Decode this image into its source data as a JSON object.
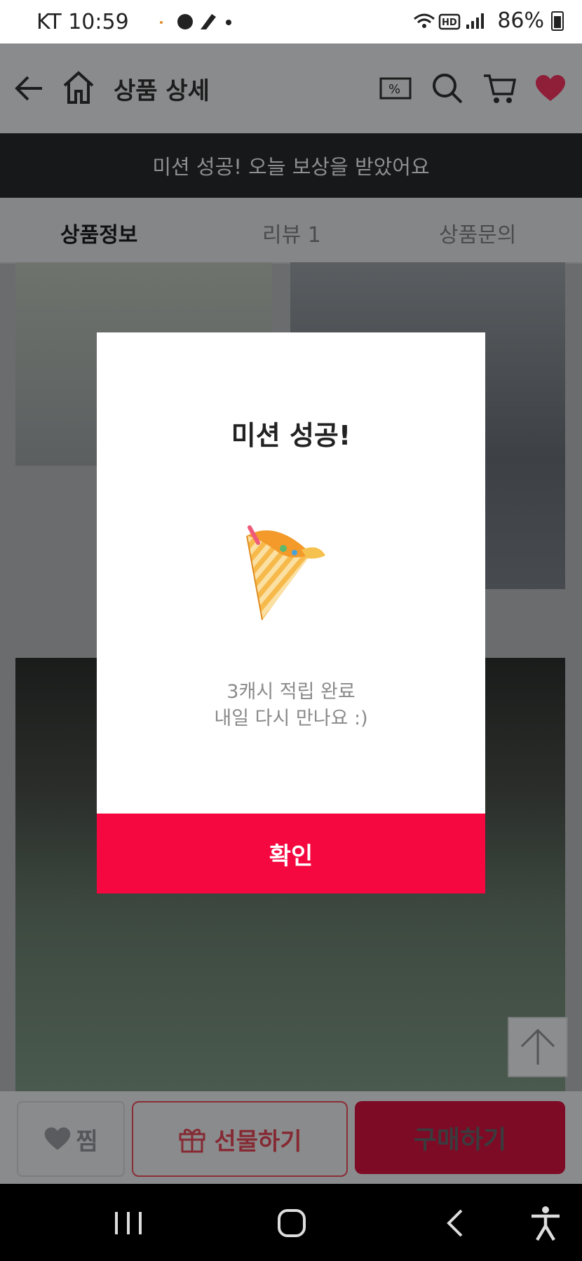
{
  "status_bar": {
    "carrier_time": "KT 10:59",
    "battery": "86%"
  },
  "header": {
    "title": "상품 상세"
  },
  "banner": {
    "text": "미션 성공! 오늘 보상을 받았어요"
  },
  "tabs": [
    {
      "label": "상품정보",
      "active": true
    },
    {
      "label": "리뷰 1",
      "active": false
    },
    {
      "label": "상품문의",
      "active": false
    }
  ],
  "bottom_bar": {
    "like_label": "찜",
    "gift_label": "선물하기",
    "buy_label": "구매하기"
  },
  "modal": {
    "title": "미션 성공!",
    "message_line1": "3캐시 적립 완료",
    "message_line2": "내일 다시 만나요 :)",
    "confirm_label": "확인"
  },
  "colors": {
    "accent": "#f5073f",
    "banner_bg": "#17181a"
  },
  "icons": [
    "back-arrow-icon",
    "home-icon",
    "discount-coupon-icon",
    "search-icon",
    "cart-icon",
    "heart-icon",
    "party-popper-icon",
    "gift-icon",
    "arrow-up-icon",
    "recent-apps-icon",
    "home-circle-icon",
    "nav-back-icon",
    "accessibility-icon"
  ]
}
